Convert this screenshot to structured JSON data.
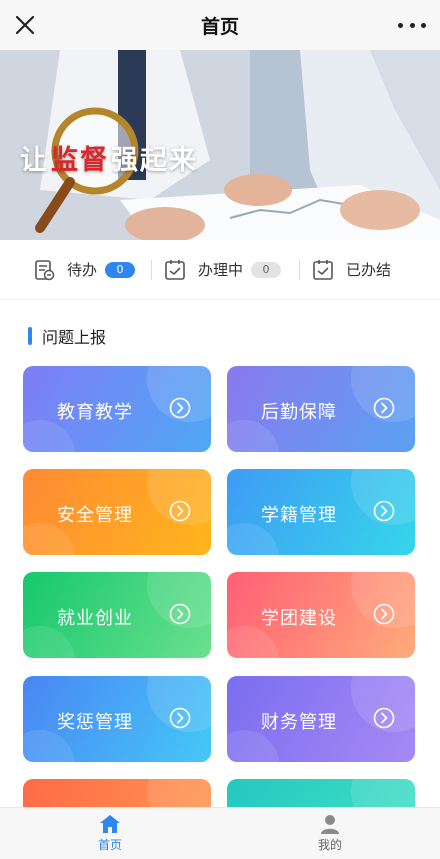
{
  "titlebar": {
    "title": "首页"
  },
  "banner": {
    "slogan_pre": "让",
    "slogan_highlight": "监督",
    "slogan_post": "强起来"
  },
  "status": [
    {
      "label": "待办",
      "count": "0"
    },
    {
      "label": "办理中",
      "count": "0"
    },
    {
      "label": "已办结"
    }
  ],
  "section": {
    "title": "问题上报"
  },
  "tiles": [
    {
      "label": "教育教学",
      "color_from": "#7f7df5",
      "color_to": "#4fa8f5"
    },
    {
      "label": "后勤保障",
      "color_from": "#8a79ef",
      "color_to": "#5aa2f2"
    },
    {
      "label": "安全管理",
      "color_from": "#ff8a34",
      "color_to": "#ffb61c"
    },
    {
      "label": "学籍管理",
      "color_from": "#3f9bf5",
      "color_to": "#35d6ea"
    },
    {
      "label": "就业创业",
      "color_from": "#17c86c",
      "color_to": "#6ae08e"
    },
    {
      "label": "学团建设",
      "color_from": "#ff5f75",
      "color_to": "#ffab7b"
    },
    {
      "label": "奖惩管理",
      "color_from": "#4a86f5",
      "color_to": "#45c8f6"
    },
    {
      "label": "财务管理",
      "color_from": "#7b6df0",
      "color_to": "#a58af4"
    },
    {
      "label": "",
      "color_from": "#ff6a47",
      "color_to": "#ff9b50"
    },
    {
      "label": "",
      "color_from": "#23c8c0",
      "color_to": "#43e0c4"
    }
  ],
  "tabbar": [
    {
      "label": "首页",
      "active": true
    },
    {
      "label": "我的",
      "active": false
    }
  ],
  "colors": {
    "accent": "#2f86f0"
  }
}
